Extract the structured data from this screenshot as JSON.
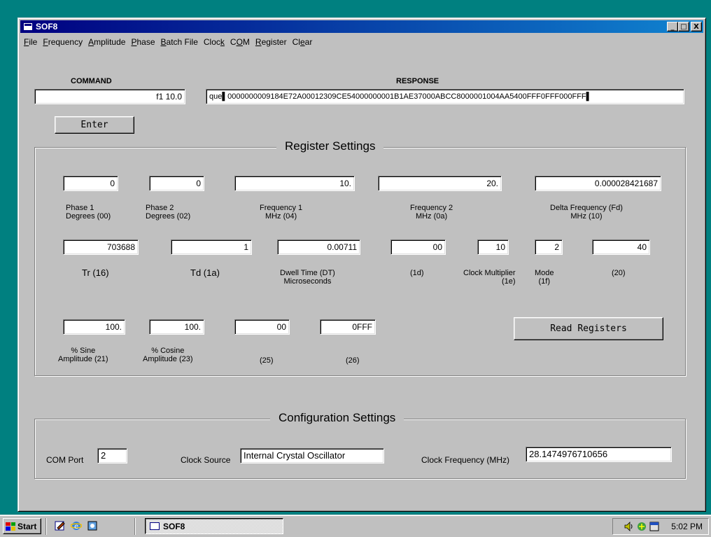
{
  "window": {
    "title": "SOF8",
    "minimize_label": "_",
    "maximize_label": "□",
    "close_label": "X"
  },
  "menu": [
    {
      "label": "File",
      "u": "F",
      "rest": "ile"
    },
    {
      "label": "Frequency",
      "u": "F",
      "rest": "requency"
    },
    {
      "label": "Amplitude",
      "u": "A",
      "rest": "mplitude"
    },
    {
      "label": "Phase",
      "u": "P",
      "rest": "hase"
    },
    {
      "label": "Batch File",
      "u": "B",
      "rest": "atch File"
    },
    {
      "label": "Clock",
      "pre": "Cloc",
      "u": "k",
      "rest": ""
    },
    {
      "label": "COM",
      "pre": "C",
      "u": "O",
      "rest": "M"
    },
    {
      "label": "Register",
      "u": "R",
      "rest": "egister"
    },
    {
      "label": "Clear",
      "pre": "Cl",
      "u": "e",
      "rest": "ar"
    }
  ],
  "command": {
    "label": "COMMAND",
    "value": "f1 10.0",
    "enter_label": "Enter"
  },
  "response": {
    "label": "RESPONSE",
    "value": "que▌0000000009184E72A00012309CE54000000001B1AE37000ABCC8000001004AA5400FFF0FFF000FFF▌"
  },
  "register_settings": {
    "title": "Register Settings",
    "phase1": {
      "value": "0",
      "label1": "Phase 1",
      "label2": "Degrees (00)"
    },
    "phase2": {
      "value": "0",
      "label1": "Phase 2",
      "label2": "Degrees (02)"
    },
    "freq1": {
      "value": "10.",
      "label1": "Frequency 1",
      "label2": "MHz (04)"
    },
    "freq2": {
      "value": "20.",
      "label1": "Frequency 2",
      "label2": "MHz (0a)"
    },
    "delta_freq": {
      "value": "0.000028421687",
      "label1": "Delta Frequency (Fd)",
      "label2": "MHz (10)"
    },
    "tr": {
      "value": "703688",
      "label": "Tr (16)"
    },
    "td": {
      "value": "1",
      "label": "Td (1a)"
    },
    "dwell": {
      "value": "0.00711",
      "label1": "Dwell Time (DT)",
      "label2": "Microseconds"
    },
    "reg_1d": {
      "value": "00",
      "label": "(1d)"
    },
    "clock_mult": {
      "value": "10",
      "label1": "Clock Multiplier",
      "label2": "(1e)"
    },
    "mode": {
      "value": "2",
      "label1": "Mode",
      "label2": "(1f)"
    },
    "reg_20": {
      "value": "40",
      "label": "(20)"
    },
    "sine_amp": {
      "value": "100.",
      "label1": "% Sine",
      "label2": "Amplitude (21)"
    },
    "cosine_amp": {
      "value": "100.",
      "label1": "% Cosine",
      "label2": "Amplitude (23)"
    },
    "reg_25": {
      "value": "00",
      "label": "(25)"
    },
    "reg_26": {
      "value": "0FFF",
      "label": "(26)"
    },
    "read_registers_label": "Read Registers"
  },
  "config_settings": {
    "title": "Configuration Settings",
    "com_port": {
      "label": "COM Port",
      "value": "2"
    },
    "clock_source": {
      "label": "Clock Source",
      "value": "Internal Crystal Oscillator"
    },
    "clock_freq": {
      "label": "Clock Frequency (MHz)",
      "value": "28.1474976710656"
    }
  },
  "taskbar": {
    "start_label": "Start",
    "task_label": "SOF8",
    "clock": "5:02 PM"
  }
}
